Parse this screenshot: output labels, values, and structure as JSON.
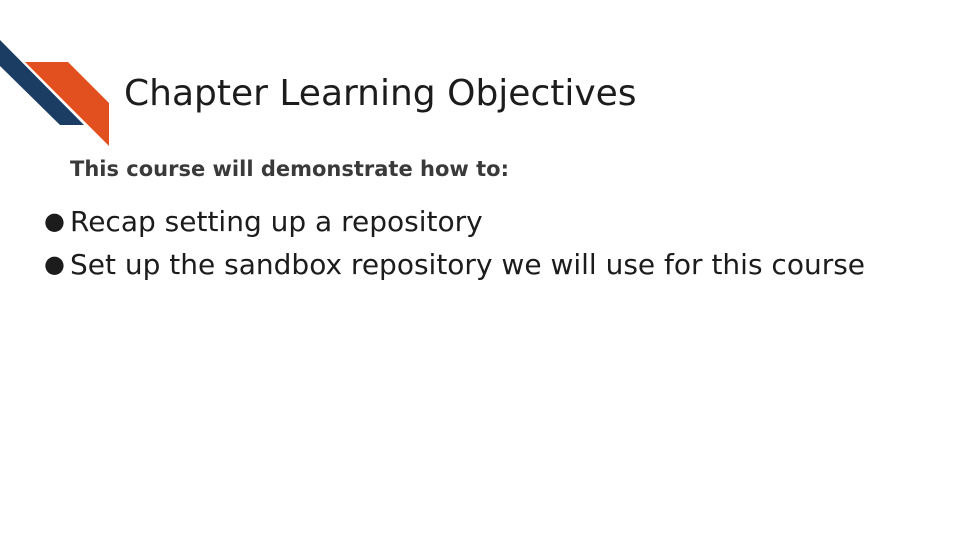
{
  "slide": {
    "title": "Chapter Learning Objectives",
    "subtitle": "This course will demonstrate how to:",
    "bullets": [
      "Recap setting up a repository",
      "Set up the sandbox repository we will use for this course"
    ],
    "bullet_glyph": "●"
  },
  "colors": {
    "accent_navy": "#1b3d63",
    "accent_orange": "#e2501f",
    "title_text": "#1c1c1c",
    "subtitle_text": "#3a3a3a",
    "background": "#ffffff"
  },
  "icons": {
    "logo": "chevron-stripes-logo"
  }
}
